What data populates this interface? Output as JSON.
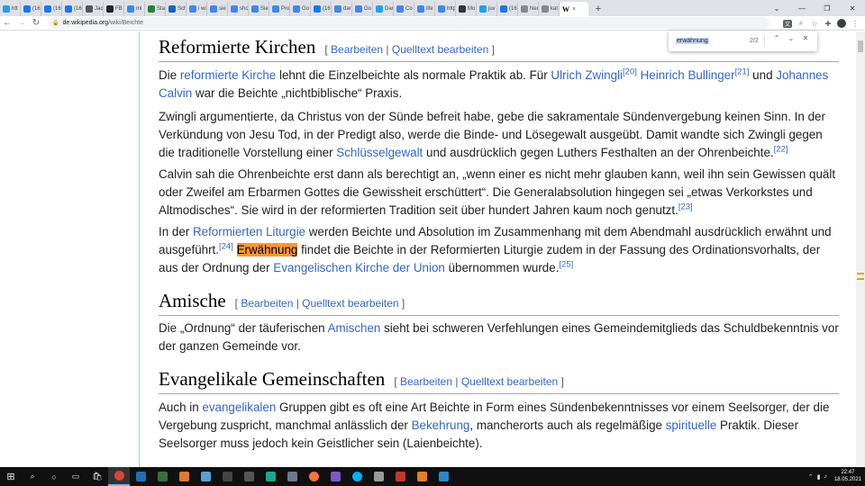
{
  "browser": {
    "tabs": [
      {
        "label": "htt",
        "icon": "twitter-icon",
        "color": "#1da1f2"
      },
      {
        "label": "(16",
        "icon": "facebook-icon",
        "color": "#1877f2"
      },
      {
        "label": "(16",
        "icon": "facebook-icon",
        "color": "#1877f2"
      },
      {
        "label": "(16",
        "icon": "facebook-icon",
        "color": "#1877f2"
      },
      {
        "label": "Jac",
        "icon": "wikipedia-icon",
        "color": "#555555"
      },
      {
        "label": "FB",
        "icon": "sz-icon",
        "color": "#222222"
      },
      {
        "label": "mi",
        "icon": "google-icon",
        "color": "#4285f4"
      },
      {
        "label": "Sta",
        "icon": "site-icon",
        "color": "#2e7d32"
      },
      {
        "label": "Sch",
        "icon": "site-icon",
        "color": "#1565c0"
      },
      {
        "label": "i wi",
        "icon": "google-icon",
        "color": "#4285f4"
      },
      {
        "label": "sie",
        "icon": "google-icon",
        "color": "#4285f4"
      },
      {
        "label": "sho",
        "icon": "google-icon",
        "color": "#4285f4"
      },
      {
        "label": "Sie",
        "icon": "google-icon",
        "color": "#4285f4"
      },
      {
        "label": "Pro",
        "icon": "google-icon",
        "color": "#4285f4"
      },
      {
        "label": "Go",
        "icon": "google-icon",
        "color": "#4285f4"
      },
      {
        "label": "(16",
        "icon": "facebook-icon",
        "color": "#1877f2"
      },
      {
        "label": "dar",
        "icon": "google-icon",
        "color": "#4285f4"
      },
      {
        "label": "Go",
        "icon": "google-icon",
        "color": "#4285f4"
      },
      {
        "label": "Dar",
        "icon": "twitter-icon",
        "color": "#1da1f2"
      },
      {
        "label": "Co",
        "icon": "google-icon",
        "color": "#4285f4"
      },
      {
        "label": "life",
        "icon": "google-icon",
        "color": "#4285f4"
      },
      {
        "label": "http",
        "icon": "google-icon",
        "color": "#4285f4"
      },
      {
        "label": "Mo",
        "icon": "site-icon",
        "color": "#333333"
      },
      {
        "label": "juv",
        "icon": "twitter-icon",
        "color": "#1da1f2"
      },
      {
        "label": "(16",
        "icon": "facebook-icon",
        "color": "#1877f2"
      },
      {
        "label": "Neuer",
        "icon": "site-icon",
        "color": "#888888"
      },
      {
        "label": "kat",
        "icon": "site-icon",
        "color": "#888888"
      }
    ],
    "active_tab": {
      "label": "W",
      "close": "×"
    },
    "new_tab": "+",
    "url_host": "de.wikipedia.org",
    "url_path": "/wiki/Beichte",
    "find": {
      "query": "erwähnung",
      "count": "2/2"
    }
  },
  "article": {
    "edit_label": "Bearbeiten",
    "source_edit_label": "Quelltext bearbeiten",
    "sections": {
      "reformiert": {
        "title": "Reformierte Kirchen",
        "p1": {
          "t1": "Die ",
          "l1": "reformierte Kirche",
          "t2": " lehnt die Einzelbeichte als normale Praktik ab. Für ",
          "l2": "Ulrich Zwingli",
          "r1": "[20]",
          "l3": "Heinrich Bullinger",
          "r2": "[21]",
          "t3": " und ",
          "l4": "Johannes Calvin",
          "t4": " war die Beichte „nichtbiblische“ Praxis."
        },
        "p2": {
          "t1": "Zwingli argumentierte, da Christus von der Sünde befreit habe, gebe die sakramentale Sündenvergebung keinen Sinn. In der Verkündung von Jesu Tod, in der Predigt also, werde die Binde- und Lösegewalt ausgeübt. Damit wandte sich Zwingli gegen die traditionelle Vorstellung einer ",
          "l1": "Schlüsselgewalt",
          "t2": " und ausdrücklich gegen Luthers Festhalten an der Ohrenbeichte.",
          "r1": "[22]"
        },
        "p3": {
          "t1": "Calvin sah die Ohrenbeichte erst dann als berechtigt an, „wenn einer es nicht mehr glauben kann, weil ihn sein Gewissen quält oder Zweifel am Erbarmen Gottes die Gewissheit erschüttert“. Die Generalabsolution hingegen sei „etwas Verkorkstes und Altmodisches“. Sie wird in der reformierten Tradition seit über hundert Jahren kaum noch genutzt.",
          "r1": "[23]"
        },
        "p4": {
          "t1": "In der ",
          "l1": "Reformierten Liturgie",
          "t2": " werden Beichte und Absolution im Zusammenhang mit dem Abendmahl ausdrücklich erwähnt und ausgeführt.",
          "r1": "[24]",
          "hl": "Erwähnung",
          "t3": " findet die Beichte in der Reformierten Liturgie zudem in der Fassung des Ordinationsvorhalts, der aus der Ordnung der ",
          "l2": "Evangelischen Kirche der Union",
          "t4": " übernommen wurde.",
          "r2": "[25]"
        }
      },
      "amische": {
        "title": "Amische",
        "p1": {
          "t1": "Die „Ordnung“ der täuferischen ",
          "l1": "Amischen",
          "t2": " sieht bei schweren Verfehlungen eines Gemeindemitglieds das Schuldbekenntnis vor der ganzen Gemeinde vor."
        }
      },
      "evangelikal": {
        "title": "Evangelikale Gemeinschaften",
        "p1": {
          "t1": "Auch in ",
          "l1": "evangelikalen",
          "t2": " Gruppen gibt es oft eine Art Beichte in Form eines Sündenbekenntnisses vor einem Seelsorger, der die Vergebung zuspricht, manchmal anlässlich der ",
          "l2": "Bekehrung",
          "t3": ", mancherorts auch als regelmäßige ",
          "l3": "spirituelle",
          "t4": " Praktik. Dieser Seelsorger muss jedoch kein Geistlicher sein (Laienbeichte)."
        }
      }
    }
  },
  "taskbar": {
    "time": "22:47",
    "date": "18.05.2021"
  }
}
